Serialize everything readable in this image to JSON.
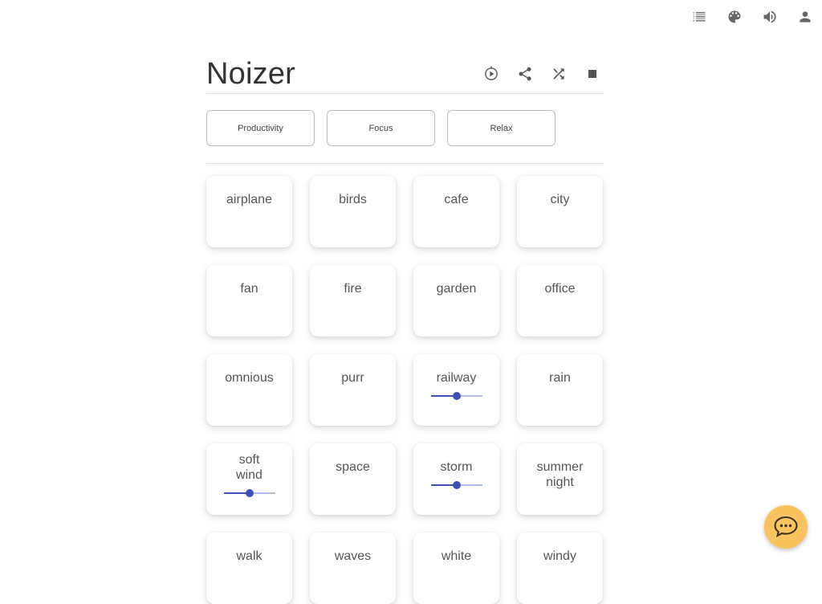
{
  "app": {
    "title": "Noizer"
  },
  "topbar": {
    "icons": [
      "list-icon",
      "palette-icon",
      "volume-icon",
      "account-icon"
    ]
  },
  "header_actions": {
    "icons": [
      "timer-play-icon",
      "share-icon",
      "shuffle-icon",
      "stop-icon"
    ]
  },
  "presets": [
    "Productivity",
    "Focus",
    "Relax"
  ],
  "sounds": [
    {
      "name": "airplane"
    },
    {
      "name": "birds"
    },
    {
      "name": "cafe"
    },
    {
      "name": "city"
    },
    {
      "name": "fan"
    },
    {
      "name": "fire"
    },
    {
      "name": "garden"
    },
    {
      "name": "office"
    },
    {
      "name": "omnious"
    },
    {
      "name": "purr"
    },
    {
      "name": "railway",
      "volume": 0.5
    },
    {
      "name": "rain"
    },
    {
      "name": "soft wind",
      "volume": 0.5
    },
    {
      "name": "space"
    },
    {
      "name": "storm",
      "volume": 0.5
    },
    {
      "name": "summer night"
    },
    {
      "name": "walk"
    },
    {
      "name": "waves"
    },
    {
      "name": "white"
    },
    {
      "name": "windy"
    }
  ],
  "chat": {
    "icon": "chat-bubble-icon",
    "color": "#f9c45f"
  },
  "colors": {
    "accent": "#3f51b5",
    "accent_track": "#b6bce8"
  }
}
